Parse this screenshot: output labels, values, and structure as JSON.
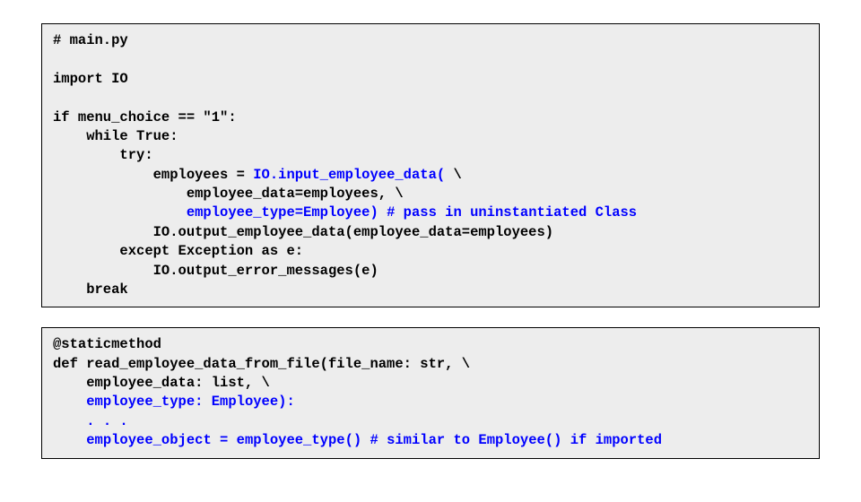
{
  "block1": {
    "l1": "# main.py",
    "l2": "",
    "l3": "import IO",
    "l4": "",
    "l5": "if menu_choice == \"1\":",
    "l6": "    while True:",
    "l7": "        try:",
    "l8a": "            employees = ",
    "l8b": "IO.input_employee_data(",
    "l8c": " \\",
    "l9": "                employee_data=employees, \\",
    "l10a": "                ",
    "l10b": "employee_type=Employee) # pass in uninstantiated Class",
    "l11": "            IO.output_employee_data(employee_data=employees)",
    "l12": "        except Exception as e:",
    "l13": "            IO.output_error_messages(e)",
    "l14": "    break"
  },
  "block2": {
    "l1": "@staticmethod",
    "l2": "def read_employee_data_from_file(file_name: str, \\",
    "l3": "    employee_data: list, \\",
    "l4a": "    ",
    "l4b": "employee_type: Employee):",
    "l5a": "    ",
    "l5b": ". . .",
    "l6a": "    ",
    "l6b": "employee_object = employee_type() # similar to Employee() if imported"
  }
}
